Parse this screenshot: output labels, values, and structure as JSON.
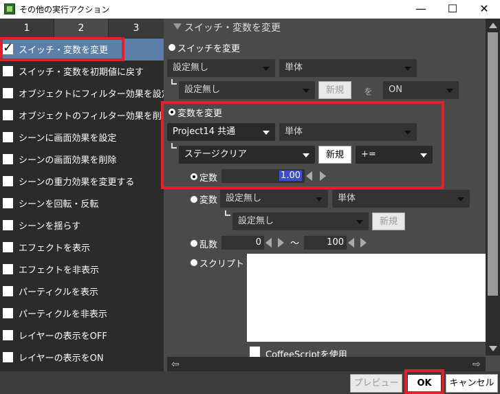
{
  "window": {
    "title": "その他の実行アクション",
    "minimize": "—",
    "maximize": "☐",
    "close": "✕"
  },
  "tabs": [
    "1",
    "2",
    "3"
  ],
  "actions": [
    {
      "label": "スイッチ・変数を変更",
      "checked": true
    },
    {
      "label": "スイッチ・変数を初期値に戻す",
      "checked": false
    },
    {
      "label": "オブジェクトにフィルター効果を設定",
      "checked": false
    },
    {
      "label": "オブジェクトのフィルター効果を削除",
      "checked": false
    },
    {
      "label": "シーンに画面効果を設定",
      "checked": false
    },
    {
      "label": "シーンの画面効果を削除",
      "checked": false
    },
    {
      "label": "シーンの重力効果を変更する",
      "checked": false
    },
    {
      "label": "シーンを回転・反転",
      "checked": false
    },
    {
      "label": "シーンを揺らす",
      "checked": false
    },
    {
      "label": "エフェクトを表示",
      "checked": false
    },
    {
      "label": "エフェクトを非表示",
      "checked": false
    },
    {
      "label": "パーティクルを表示",
      "checked": false
    },
    {
      "label": "パーティクルを非表示",
      "checked": false
    },
    {
      "label": "レイヤーの表示をOFF",
      "checked": false
    },
    {
      "label": "レイヤーの表示をON",
      "checked": false
    }
  ],
  "panel": {
    "section_title": "スイッチ・変数を変更",
    "switch_section": {
      "radio_label": "スイッチを変更",
      "dropdown1": "設定無し",
      "dropdown2": "単体",
      "sub_dropdown": "設定無し",
      "new_button": "新規",
      "to_label": "を",
      "state_dropdown": "ON"
    },
    "variable_section": {
      "radio_label": "変数を変更",
      "project_dropdown": "Project14 共通",
      "scope_dropdown": "単体",
      "variable_dropdown": "ステージクリア",
      "new_button": "新規",
      "operator_dropdown": "+=",
      "constant_label": "定数",
      "constant_value": "1.00",
      "variable_label": "変数",
      "var_dropdown1": "設定無し",
      "var_dropdown2": "単体",
      "var_sub_dropdown": "設定無し",
      "var_new_button": "新規",
      "random_label": "乱数",
      "random_min": "0",
      "random_tilde": "〜",
      "random_max": "100",
      "script_label": "スクリプト",
      "coffeescript_label": "CoffeeScriptを使用"
    }
  },
  "footer": {
    "preview_button": "プレビュー",
    "ok_button": "OK",
    "cancel_button": "キャンセル"
  }
}
